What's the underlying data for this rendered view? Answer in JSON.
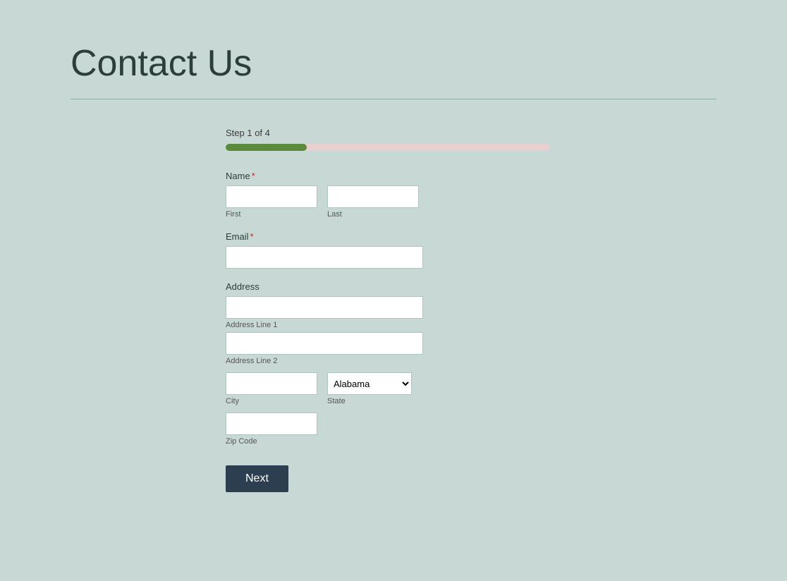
{
  "page": {
    "title": "Contact Us"
  },
  "step": {
    "label": "Step 1 of 4",
    "current": 1,
    "total": 4,
    "progress_percent": 25
  },
  "form": {
    "name_label": "Name",
    "name_required": "*",
    "first_label": "First",
    "last_label": "Last",
    "email_label": "Email",
    "email_required": "*",
    "address_label": "Address",
    "address_line1_label": "Address Line 1",
    "address_line2_label": "Address Line 2",
    "city_label": "City",
    "state_label": "State",
    "state_default": "Alabama",
    "zip_label": "Zip Code",
    "next_button": "Next"
  }
}
